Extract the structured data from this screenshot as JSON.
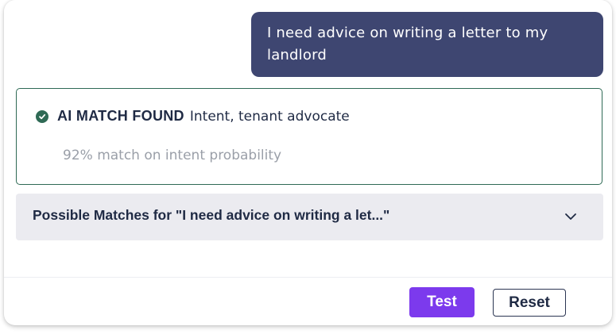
{
  "chat": {
    "user_message": "I need advice on writing a letter to my landlord"
  },
  "match": {
    "title": "AI MATCH FOUND",
    "intent": "Intent, tenant advocate",
    "probability_text": "92% match on intent probability",
    "icon": "check-circle-icon"
  },
  "possible_matches": {
    "label": "Possible Matches for \"I need advice on writing a let...\"",
    "icon": "chevron-down-icon"
  },
  "buttons": {
    "test_label": "Test",
    "reset_label": "Reset"
  },
  "colors": {
    "bubble": "#3e4671",
    "match_border": "#2f6a55",
    "primary": "#7c3aed",
    "panel": "#ebebf0"
  }
}
